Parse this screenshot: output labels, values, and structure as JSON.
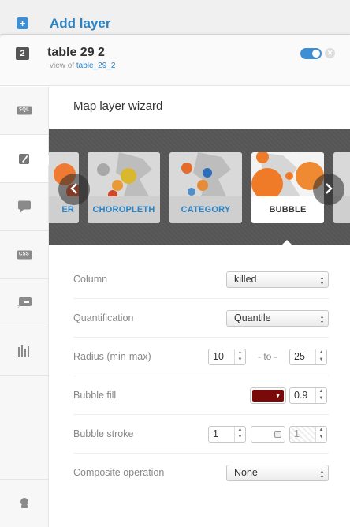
{
  "top": {
    "add_layer_label": "Add layer"
  },
  "layer": {
    "number": "2",
    "title": "table 29 2",
    "subtitle_prefix": "view of",
    "subtitle_link": "table_29_2"
  },
  "side_toolbar": {
    "items": [
      {
        "name": "sql",
        "label": "SQL"
      },
      {
        "name": "wizard",
        "icon": "paintbrush-icon"
      },
      {
        "name": "infowindow",
        "icon": "speech-bubble-icon"
      },
      {
        "name": "css",
        "label": "CSS"
      },
      {
        "name": "legend",
        "icon": "legend-icon"
      },
      {
        "name": "filters",
        "icon": "bar-filter-icon"
      }
    ],
    "bottom_icon": "add-person-icon"
  },
  "wizard": {
    "title": "Map layer wizard",
    "cards": [
      {
        "label": "ER",
        "selected": false
      },
      {
        "label": "CHOROPLETH",
        "selected": false
      },
      {
        "label": "CATEGORY",
        "selected": false
      },
      {
        "label": "BUBBLE",
        "selected": true
      }
    ],
    "rows": {
      "column": {
        "label": "Column",
        "value": "killed"
      },
      "quantification": {
        "label": "Quantification",
        "value": "Quantile"
      },
      "radius": {
        "label": "Radius (min-max)",
        "min": "10",
        "to": "- to -",
        "max": "25"
      },
      "bubble_fill": {
        "label": "Bubble fill",
        "color": "#7a0a0a",
        "opacity": "0.9"
      },
      "bubble_stroke": {
        "label": "Bubble stroke",
        "width": "1",
        "opacity": "1"
      },
      "composite": {
        "label": "Composite operation",
        "value": "None"
      }
    }
  }
}
